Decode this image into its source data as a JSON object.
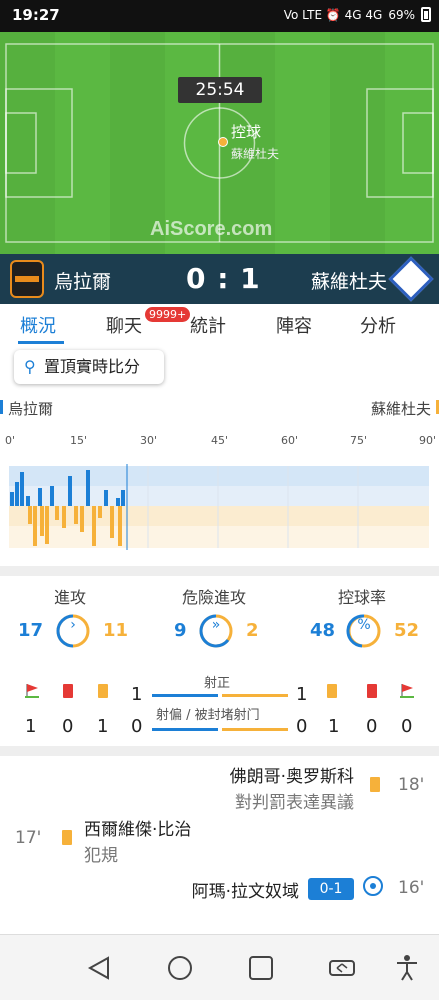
{
  "status_bar": {
    "time": "19:27",
    "indicators": "Vo LTE ⏰ 4G 4G",
    "battery": "69%"
  },
  "pitch": {
    "match_clock": "25:54",
    "possession_label": "控球",
    "possession_team": "蘇維杜夫",
    "watermark": "AiScore.com"
  },
  "scoreboard": {
    "home_team": "烏拉爾",
    "away_team": "蘇維杜夫",
    "score": "0 : 1"
  },
  "tabs": [
    {
      "label": "概況",
      "active": true
    },
    {
      "label": "聊天",
      "badge": "9999+"
    },
    {
      "label": "統計"
    },
    {
      "label": "陣容"
    },
    {
      "label": "分析"
    }
  ],
  "pin_button": {
    "label": "置頂實時比分"
  },
  "momentum": {
    "home_label": "烏拉爾",
    "away_label": "蘇維杜夫",
    "minute_ticks": [
      "0'",
      "15'",
      "30'",
      "45'",
      "60'",
      "75'",
      "90'"
    ]
  },
  "stats": {
    "attack": {
      "title": "進攻",
      "home": "17",
      "away": "11"
    },
    "dangerous_attack": {
      "title": "危險進攻",
      "home": "9",
      "away": "2"
    },
    "possession": {
      "title": "控球率",
      "home": "48",
      "away": "52",
      "glyph": "%"
    },
    "shots_on_target": {
      "label": "射正",
      "home": "1",
      "away": "1"
    },
    "shots_off_blocked": {
      "label": "射偏 / 被封堵射门",
      "home": "0",
      "away": "0"
    },
    "home_counts": {
      "corners": "1",
      "red_cards": "0",
      "yellow_cards": "1"
    },
    "away_counts": {
      "yellow_cards": "1",
      "red_cards": "0",
      "corners": "0"
    }
  },
  "events": [
    {
      "player": "佛朗哥·奥罗斯科",
      "detail": "對判罰表達異議",
      "minute": "18'",
      "side": "away",
      "type": "yellow-card"
    },
    {
      "player": "西爾維傑·比治",
      "detail": "犯規",
      "minute": "17'",
      "side": "home",
      "type": "yellow-card"
    },
    {
      "player": "阿瑪·拉文奴域",
      "score": "0-1",
      "minute": "16'",
      "side": "away",
      "type": "goal"
    }
  ],
  "colors": {
    "accent": "#1c7fd6",
    "away": "#f6b13a",
    "pitch": "#5bb842",
    "scorebar": "#1c3d4f"
  }
}
